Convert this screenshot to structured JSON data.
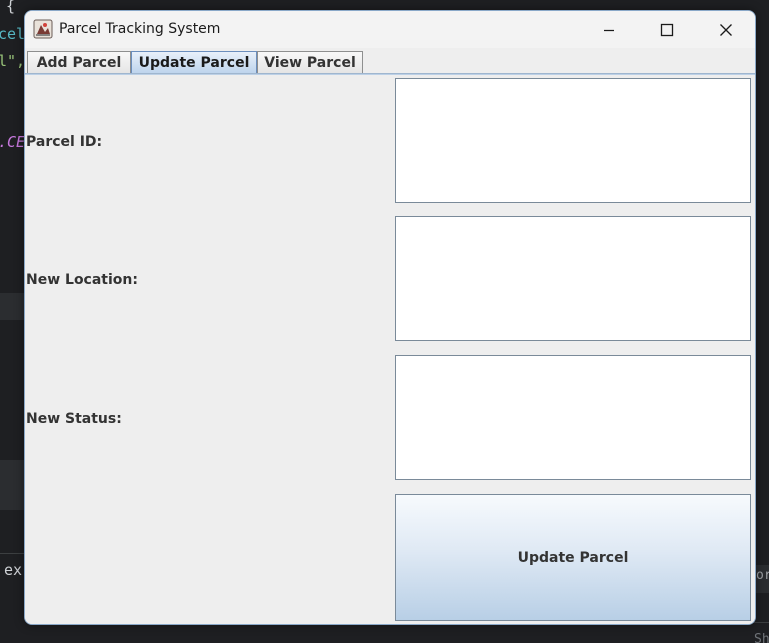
{
  "background": {
    "fragments": [
      {
        "text": "{",
        "color": "#cfd2d6"
      },
      {
        "text": "cel",
        "color": "#56b6c2"
      },
      {
        "text": "l\",",
        "color": "#98c379"
      },
      {
        "text": ".CE",
        "color": "#c678dd"
      },
      {
        "text": "ex",
        "color": "#cfd2d6"
      },
      {
        "text": "or",
        "color": "#9da0a4"
      },
      {
        "text": "Sh",
        "color": "#6f7378"
      }
    ]
  },
  "window": {
    "title": "Parcel Tracking System",
    "icon": "java-app-icon",
    "controls": {
      "minimize": "minimize-icon",
      "maximize": "maximize-icon",
      "close": "close-icon"
    }
  },
  "tabs": [
    {
      "label": "Add Parcel",
      "selected": false
    },
    {
      "label": "Update Parcel",
      "selected": true
    },
    {
      "label": "View Parcel",
      "selected": false
    }
  ],
  "form": {
    "parcel_id": {
      "label": "Parcel ID:",
      "value": ""
    },
    "new_location": {
      "label": "New Location:",
      "value": ""
    },
    "new_status": {
      "label": "New Status:",
      "value": ""
    },
    "submit_label": "Update Parcel"
  },
  "colors": {
    "selected_tab": "#bcd3ec",
    "button_gradient_bottom": "#b8cfe6",
    "window_border": "#8aa8c8"
  }
}
